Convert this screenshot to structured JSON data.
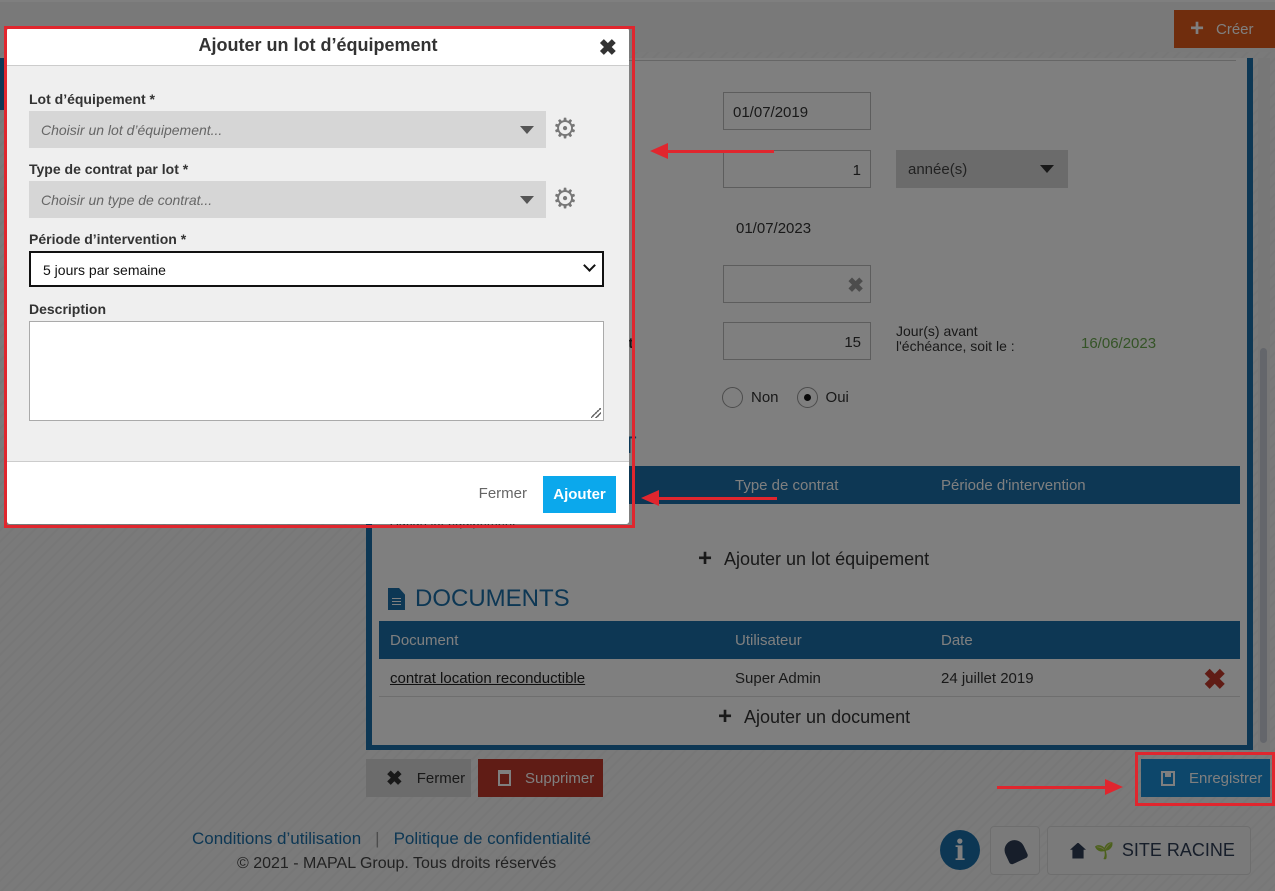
{
  "topbar": {
    "create_label": "Créer"
  },
  "form": {
    "start_date": "01/07/2019",
    "duration_value": "1",
    "duration_unit": "année(s)",
    "end_date": "01/07/2023",
    "notice_label_tail": "at",
    "notice_days": "15",
    "notice_days_label": "Jour(s) avant l'échéance, soit le :",
    "notice_date": "16/06/2023",
    "tacit_options": [
      {
        "label": "Non",
        "selected": false
      },
      {
        "label": "Oui",
        "selected": true
      }
    ],
    "section_tail": "T"
  },
  "lots_table": {
    "headers": [
      "Type de contrat",
      "Période d'intervention"
    ],
    "empty_text": "Aucun lot équipement",
    "add_label": "Ajouter un lot équipement"
  },
  "documents": {
    "title": "DOCUMENTS",
    "headers": [
      "Document",
      "Utilisateur",
      "Date"
    ],
    "rows": [
      {
        "document": "contrat location reconductible",
        "user": "Super Admin",
        "date": "24 juillet 2019"
      }
    ],
    "add_label": "Ajouter un document"
  },
  "actions": {
    "close_label": "Fermer",
    "delete_label": "Supprimer",
    "save_label": "Enregistrer"
  },
  "footer": {
    "terms": "Conditions d’utilisation",
    "separator": "|",
    "privacy": "Politique de confidentialité",
    "copyright": "© 2021 - MAPAL Group. Tous droits réservés",
    "site_label": "SITE RACINE"
  },
  "modal": {
    "title": "Ajouter un lot d’équipement",
    "fields": {
      "lot_label": "Lot d’équipement *",
      "lot_placeholder": "Choisir un lot d’équipement...",
      "contract_label": "Type de contrat par lot *",
      "contract_placeholder": "Choisir un type de contrat...",
      "period_label": "Période d’intervention *",
      "period_value": "5 jours par semaine",
      "description_label": "Description",
      "description_value": ""
    },
    "close_label": "Fermer",
    "submit_label": "Ajouter"
  },
  "colors": {
    "accent": "#1a6fa8",
    "create": "#e05a1a",
    "delete": "#c0392b",
    "save": "#1a8fd6",
    "submit": "#0ba8ec",
    "annotation": "#e0262e",
    "notice_date": "#6aa84f"
  }
}
